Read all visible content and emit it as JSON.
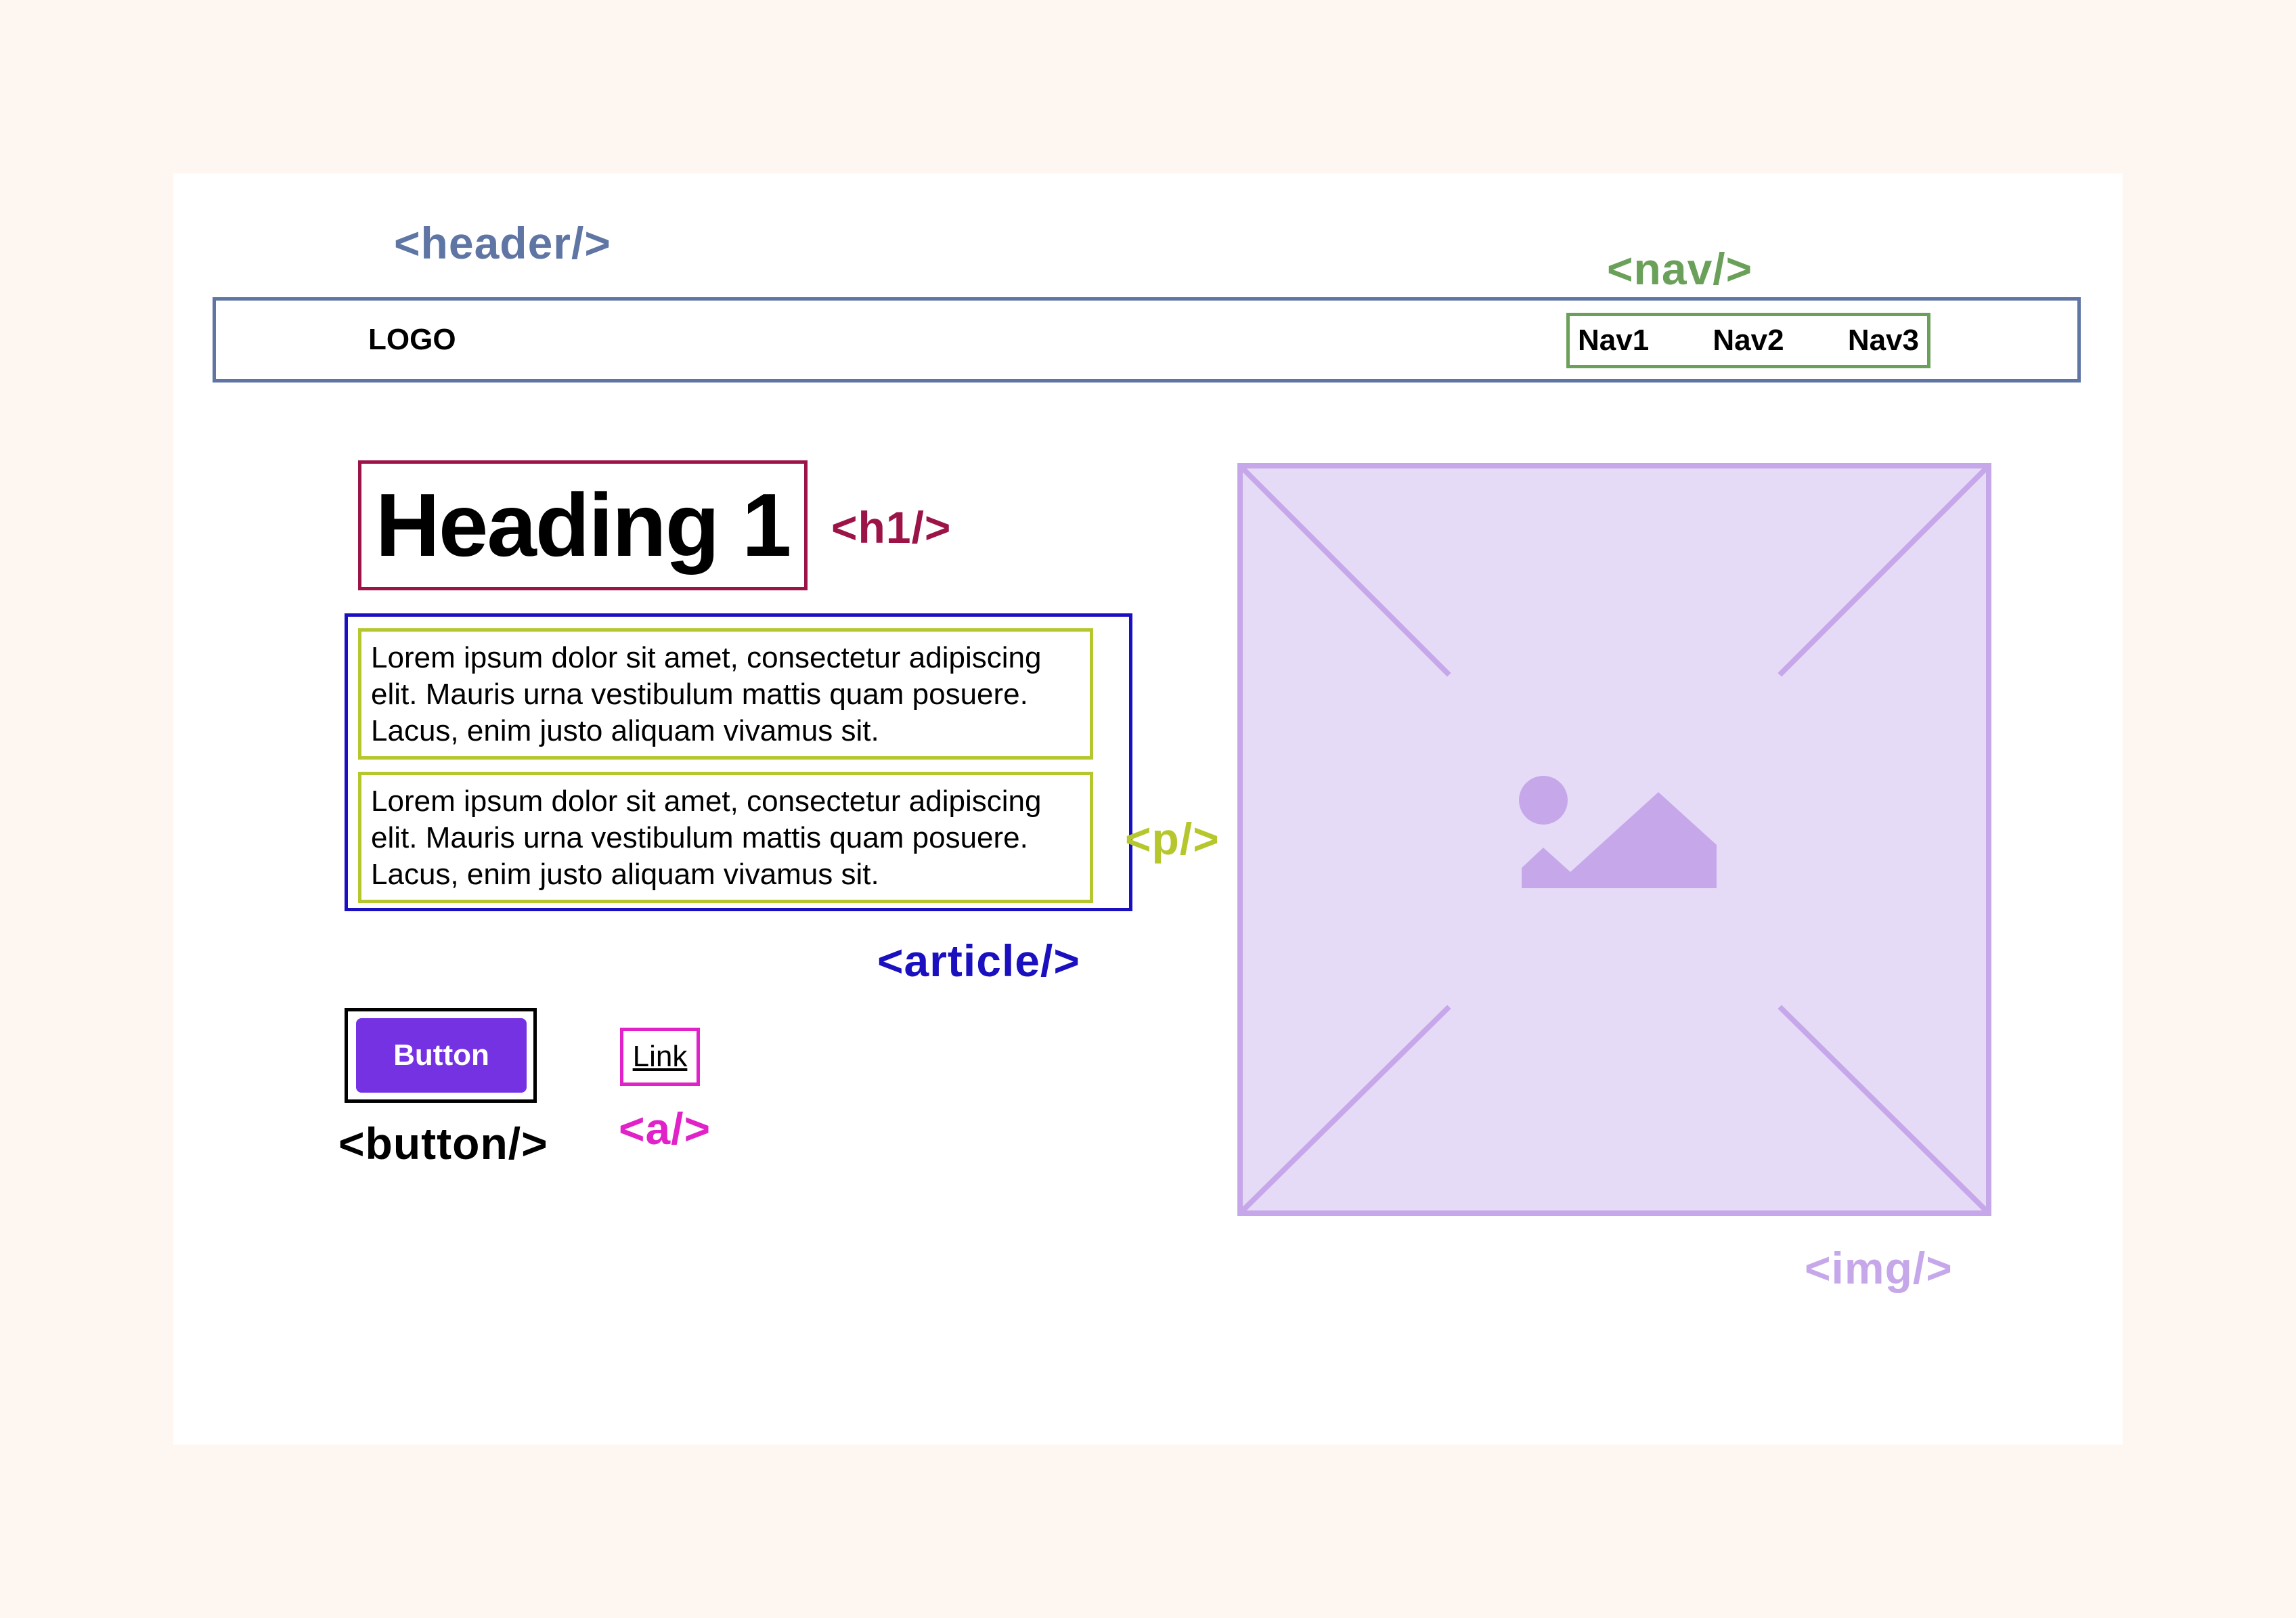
{
  "tags": {
    "header": "<header/>",
    "nav": "<nav/>",
    "h1": "<h1/>",
    "p": "<p/>",
    "article": "<article/>",
    "button": "<button/>",
    "a": "<a/>",
    "img": "<img/>"
  },
  "header": {
    "logo": "LOGO",
    "nav_items": [
      "Nav1",
      "Nav2",
      "Nav3"
    ]
  },
  "main": {
    "heading": "Heading 1",
    "paragraphs": [
      "Lorem ipsum dolor sit amet, consectetur adipiscing elit. Mauris urna vestibulum mattis quam posuere. Lacus, enim justo aliquam vivamus sit.",
      "Lorem ipsum dolor sit amet, consectetur adipiscing elit. Mauris urna vestibulum mattis quam posuere. Lacus, enim justo aliquam vivamus sit."
    ],
    "button_label": "Button",
    "link_label": "Link"
  },
  "image": {
    "icon": "image-placeholder-icon"
  },
  "colors": {
    "background": "#fdf6f1",
    "card": "#ffffff",
    "header": "#5f75a4",
    "nav": "#6ba05a",
    "h1": "#9c1447",
    "p": "#b6c72d",
    "article": "#1a10c0",
    "button_bg": "#7532e3",
    "a": "#e022c8",
    "img_fill": "#e6dbf7",
    "img_stroke": "#c6a8ea"
  }
}
